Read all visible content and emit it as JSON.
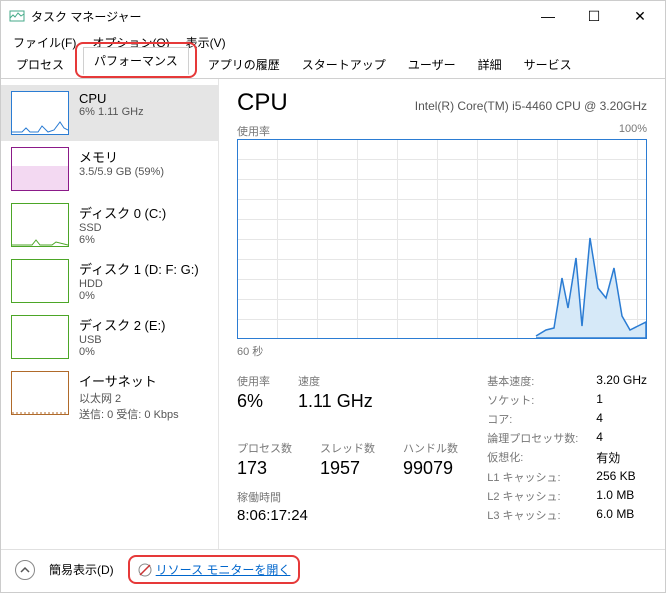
{
  "window": {
    "title": "タスク マネージャー"
  },
  "menu": {
    "file": "ファイル(F)",
    "options": "オプション(O)",
    "view": "表示(V)"
  },
  "tabs": {
    "processes": "プロセス",
    "performance": "パフォーマンス",
    "app_history": "アプリの履歴",
    "startup": "スタートアップ",
    "users": "ユーザー",
    "details": "詳細",
    "services": "サービス"
  },
  "sidebar": [
    {
      "title": "CPU",
      "sub1": "6%  1.11 GHz",
      "sub2": "",
      "color": "#2b7cd3"
    },
    {
      "title": "メモリ",
      "sub1": "3.5/5.9 GB (59%)",
      "sub2": "",
      "color": "#8b1a89"
    },
    {
      "title": "ディスク 0 (C:)",
      "sub1": "SSD",
      "sub2": "6%",
      "color": "#4ca627"
    },
    {
      "title": "ディスク 1 (D: F: G:)",
      "sub1": "HDD",
      "sub2": "0%",
      "color": "#4ca627"
    },
    {
      "title": "ディスク 2 (E:)",
      "sub1": "USB",
      "sub2": "0%",
      "color": "#4ca627"
    },
    {
      "title": "イーサネット",
      "sub1": "以太网 2",
      "sub2": "送信: 0 受信: 0 Kbps",
      "color": "#b06a2a"
    }
  ],
  "main": {
    "heading": "CPU",
    "subheading": "Intel(R) Core(TM) i5-4460 CPU @ 3.20GHz",
    "chart_top_left": "使用率",
    "chart_top_right": "100%",
    "chart_bottom": "60 秒",
    "stats": {
      "util_label": "使用率",
      "util_value": "6%",
      "speed_label": "速度",
      "speed_value": "1.11 GHz",
      "proc_label": "プロセス数",
      "proc_value": "173",
      "threads_label": "スレッド数",
      "threads_value": "1957",
      "handles_label": "ハンドル数",
      "handles_value": "99079",
      "uptime_label": "稼働時間",
      "uptime_value": "8:06:17:24"
    },
    "info": {
      "base_speed_k": "基本速度:",
      "base_speed_v": "3.20 GHz",
      "sockets_k": "ソケット:",
      "sockets_v": "1",
      "cores_k": "コア:",
      "cores_v": "4",
      "lprocs_k": "論理プロセッサ数:",
      "lprocs_v": "4",
      "virt_k": "仮想化:",
      "virt_v": "有効",
      "l1_k": "L1 キャッシュ:",
      "l1_v": "256 KB",
      "l2_k": "L2 キャッシュ:",
      "l2_v": "1.0 MB",
      "l3_k": "L3 キャッシュ:",
      "l3_v": "6.0 MB"
    }
  },
  "statusbar": {
    "fewer": "簡易表示(D)",
    "resmon": "リソース モニターを開く"
  },
  "chart_data": {
    "type": "line",
    "title": "CPU 使用率",
    "ylabel": "使用率",
    "ylim": [
      0,
      100
    ],
    "xlabel": "60 秒",
    "values_pct_recent_to_old": [
      8,
      5,
      14,
      48,
      32,
      24,
      52,
      8,
      30,
      42,
      18,
      8,
      5,
      4,
      3,
      3,
      3,
      3,
      3,
      3,
      3,
      3,
      3,
      3,
      3,
      3,
      3,
      3,
      3,
      3,
      3,
      3,
      3,
      3,
      3,
      3,
      3,
      3,
      3,
      3,
      3,
      3,
      3,
      3,
      3,
      3,
      3,
      3,
      3,
      3,
      3,
      3,
      3,
      3,
      3,
      3,
      3,
      3,
      3,
      3
    ]
  }
}
